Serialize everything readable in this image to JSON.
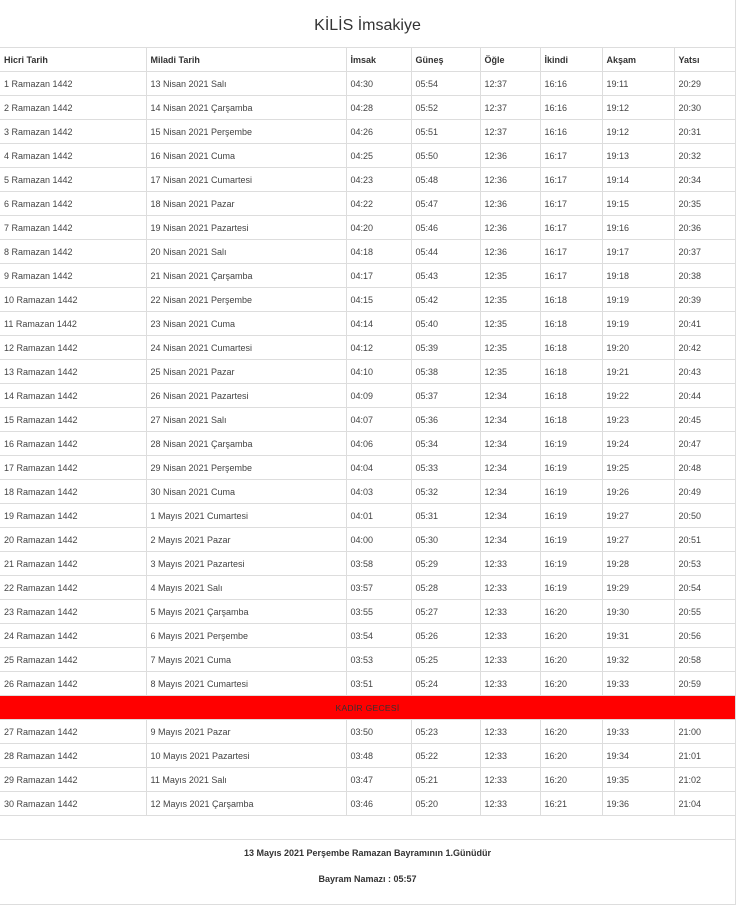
{
  "title": "KİLİS İmsakiye",
  "columns": [
    "Hicri Tarih",
    "Miladi Tarih",
    "İmsak",
    "Güneş",
    "Öğle",
    "İkindi",
    "Akşam",
    "Yatsı"
  ],
  "rows_before": [
    [
      "1 Ramazan 1442",
      "13 Nisan 2021 Salı",
      "04:30",
      "05:54",
      "12:37",
      "16:16",
      "19:11",
      "20:29"
    ],
    [
      "2 Ramazan 1442",
      "14 Nisan 2021 Çarşamba",
      "04:28",
      "05:52",
      "12:37",
      "16:16",
      "19:12",
      "20:30"
    ],
    [
      "3 Ramazan 1442",
      "15 Nisan 2021 Perşembe",
      "04:26",
      "05:51",
      "12:37",
      "16:16",
      "19:12",
      "20:31"
    ],
    [
      "4 Ramazan 1442",
      "16 Nisan 2021 Cuma",
      "04:25",
      "05:50",
      "12:36",
      "16:17",
      "19:13",
      "20:32"
    ],
    [
      "5 Ramazan 1442",
      "17 Nisan 2021 Cumartesi",
      "04:23",
      "05:48",
      "12:36",
      "16:17",
      "19:14",
      "20:34"
    ],
    [
      "6 Ramazan 1442",
      "18 Nisan 2021 Pazar",
      "04:22",
      "05:47",
      "12:36",
      "16:17",
      "19:15",
      "20:35"
    ],
    [
      "7 Ramazan 1442",
      "19 Nisan 2021 Pazartesi",
      "04:20",
      "05:46",
      "12:36",
      "16:17",
      "19:16",
      "20:36"
    ],
    [
      "8 Ramazan 1442",
      "20 Nisan 2021 Salı",
      "04:18",
      "05:44",
      "12:36",
      "16:17",
      "19:17",
      "20:37"
    ],
    [
      "9 Ramazan 1442",
      "21 Nisan 2021 Çarşamba",
      "04:17",
      "05:43",
      "12:35",
      "16:17",
      "19:18",
      "20:38"
    ],
    [
      "10 Ramazan 1442",
      "22 Nisan 2021 Perşembe",
      "04:15",
      "05:42",
      "12:35",
      "16:18",
      "19:19",
      "20:39"
    ],
    [
      "11 Ramazan 1442",
      "23 Nisan 2021 Cuma",
      "04:14",
      "05:40",
      "12:35",
      "16:18",
      "19:19",
      "20:41"
    ],
    [
      "12 Ramazan 1442",
      "24 Nisan 2021 Cumartesi",
      "04:12",
      "05:39",
      "12:35",
      "16:18",
      "19:20",
      "20:42"
    ],
    [
      "13 Ramazan 1442",
      "25 Nisan 2021 Pazar",
      "04:10",
      "05:38",
      "12:35",
      "16:18",
      "19:21",
      "20:43"
    ],
    [
      "14 Ramazan 1442",
      "26 Nisan 2021 Pazartesi",
      "04:09",
      "05:37",
      "12:34",
      "16:18",
      "19:22",
      "20:44"
    ],
    [
      "15 Ramazan 1442",
      "27 Nisan 2021 Salı",
      "04:07",
      "05:36",
      "12:34",
      "16:18",
      "19:23",
      "20:45"
    ],
    [
      "16 Ramazan 1442",
      "28 Nisan 2021 Çarşamba",
      "04:06",
      "05:34",
      "12:34",
      "16:19",
      "19:24",
      "20:47"
    ],
    [
      "17 Ramazan 1442",
      "29 Nisan 2021 Perşembe",
      "04:04",
      "05:33",
      "12:34",
      "16:19",
      "19:25",
      "20:48"
    ],
    [
      "18 Ramazan 1442",
      "30 Nisan 2021 Cuma",
      "04:03",
      "05:32",
      "12:34",
      "16:19",
      "19:26",
      "20:49"
    ],
    [
      "19 Ramazan 1442",
      "1 Mayıs 2021 Cumartesi",
      "04:01",
      "05:31",
      "12:34",
      "16:19",
      "19:27",
      "20:50"
    ],
    [
      "20 Ramazan 1442",
      "2 Mayıs 2021 Pazar",
      "04:00",
      "05:30",
      "12:34",
      "16:19",
      "19:27",
      "20:51"
    ],
    [
      "21 Ramazan 1442",
      "3 Mayıs 2021 Pazartesi",
      "03:58",
      "05:29",
      "12:33",
      "16:19",
      "19:28",
      "20:53"
    ],
    [
      "22 Ramazan 1442",
      "4 Mayıs 2021 Salı",
      "03:57",
      "05:28",
      "12:33",
      "16:19",
      "19:29",
      "20:54"
    ],
    [
      "23 Ramazan 1442",
      "5 Mayıs 2021 Çarşamba",
      "03:55",
      "05:27",
      "12:33",
      "16:20",
      "19:30",
      "20:55"
    ],
    [
      "24 Ramazan 1442",
      "6 Mayıs 2021 Perşembe",
      "03:54",
      "05:26",
      "12:33",
      "16:20",
      "19:31",
      "20:56"
    ],
    [
      "25 Ramazan 1442",
      "7 Mayıs 2021 Cuma",
      "03:53",
      "05:25",
      "12:33",
      "16:20",
      "19:32",
      "20:58"
    ],
    [
      "26 Ramazan 1442",
      "8 Mayıs 2021 Cumartesi",
      "03:51",
      "05:24",
      "12:33",
      "16:20",
      "19:33",
      "20:59"
    ]
  ],
  "kadir_gecesi": "KADİR GECESİ",
  "rows_after": [
    [
      "27 Ramazan 1442",
      "9 Mayıs 2021 Pazar",
      "03:50",
      "05:23",
      "12:33",
      "16:20",
      "19:33",
      "21:00"
    ],
    [
      "28 Ramazan 1442",
      "10 Mayıs 2021 Pazartesi",
      "03:48",
      "05:22",
      "12:33",
      "16:20",
      "19:34",
      "21:01"
    ],
    [
      "29 Ramazan 1442",
      "11 Mayıs 2021 Salı",
      "03:47",
      "05:21",
      "12:33",
      "16:20",
      "19:35",
      "21:02"
    ],
    [
      "30 Ramazan 1442",
      "12 Mayıs 2021 Çarşamba",
      "03:46",
      "05:20",
      "12:33",
      "16:21",
      "19:36",
      "21:04"
    ]
  ],
  "footer": {
    "bayram_note": "13 Mayıs 2021 Perşembe Ramazan Bayramının 1.Günüdür",
    "bayram_namazi": "Bayram Namazı : 05:57"
  },
  "colors": {
    "highlight": "#ff0000",
    "border": "#dddddd"
  }
}
